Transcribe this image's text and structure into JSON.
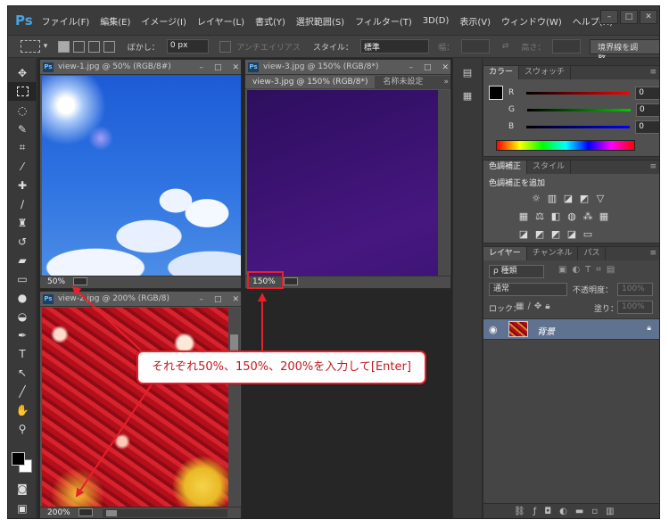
{
  "app": {
    "logo": "Ps"
  },
  "menu": [
    "ファイル(F)",
    "編集(E)",
    "イメージ(I)",
    "レイヤー(L)",
    "書式(Y)",
    "選択範囲(S)",
    "フィルター(T)",
    "3D(D)",
    "表示(V)",
    "ウィンドウ(W)",
    "ヘルプ(H)"
  ],
  "window_controls": {
    "minimize": "–",
    "restore": "□",
    "close": "✕"
  },
  "options": {
    "feather_label": "ぼかし：",
    "feather_value": "0 px",
    "antialias_label": "アンチエイリアス",
    "style_label": "スタイル：",
    "style_value": "標準",
    "width_label": "幅：",
    "height_label": "高さ：",
    "refine_edge_button": "境界線を調整..."
  },
  "documents": {
    "doc1": {
      "title": "view-1.jpg @ 50% (RGB/8#)",
      "zoom": "50%"
    },
    "doc3": {
      "title": "view-3.jpg @ 150% (RGB/8*)",
      "tab1": "view-3.jpg @ 150% (RGB/8*)",
      "tab2": "名称未設定",
      "zoom": "150%"
    },
    "doc2": {
      "title": "view-2.jpg @ 200% (RGB/8)",
      "zoom": "200%"
    }
  },
  "panels": {
    "color": {
      "tab_color": "カラー",
      "tab_swatches": "スウォッチ",
      "r_label": "R",
      "g_label": "G",
      "b_label": "B",
      "r_value": "0",
      "g_value": "0",
      "b_value": "0"
    },
    "adjustments": {
      "tab_adjust": "色調補正",
      "tab_style": "スタイル",
      "hint": "色調補正を追加"
    },
    "layers": {
      "tab_layers": "レイヤー",
      "tab_channels": "チャンネル",
      "tab_paths": "パス",
      "filter_kind": "ρ 種類",
      "blend_mode": "通常",
      "opacity_label": "不透明度：",
      "opacity_value": "100%",
      "lock_label": "ロック：",
      "fill_label": "塗り：",
      "fill_value": "100%",
      "layer_name": "背景"
    }
  },
  "annotation": {
    "callout_text": "それぞれ50%、150%、200%を入力して[Enter]"
  },
  "colors": {
    "accent_red": "#e8202a",
    "layer_selected": "#5f7290",
    "ps_blue": "#4aa3df"
  }
}
